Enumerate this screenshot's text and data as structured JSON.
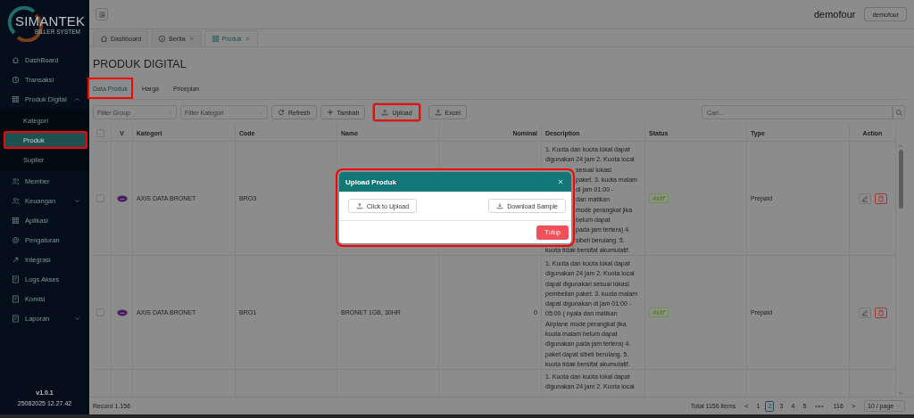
{
  "sidebar": {
    "logo": {
      "name": "SIMANTEK",
      "tagline": "BILLER SYSTEM"
    },
    "items": [
      {
        "label": "DashBoard",
        "selected": false,
        "highlighted": false
      },
      {
        "label": "Transaksi",
        "selected": false,
        "highlighted": false
      },
      {
        "label": "Produk Digital",
        "selected": false,
        "highlighted": false,
        "expanded": true,
        "children": [
          {
            "label": "Kategori",
            "selected": false,
            "highlighted": false
          },
          {
            "label": "Produk",
            "selected": true,
            "highlighted": true
          },
          {
            "label": "Suplier",
            "selected": false,
            "highlighted": false
          }
        ]
      },
      {
        "label": "Member",
        "selected": false,
        "highlighted": false
      },
      {
        "label": "Keuangan",
        "selected": false,
        "highlighted": false,
        "expanded": false
      },
      {
        "label": "Aplikasi",
        "selected": false,
        "highlighted": false
      },
      {
        "label": "Pengaturan",
        "selected": false,
        "highlighted": false
      },
      {
        "label": "Integrasi",
        "selected": false,
        "highlighted": false
      },
      {
        "label": "Logs Akses",
        "selected": false,
        "highlighted": false
      },
      {
        "label": "Komisi",
        "selected": false,
        "highlighted": false
      },
      {
        "label": "Laporan",
        "selected": false,
        "highlighted": false,
        "expanded": false
      }
    ],
    "version": "v1.0.1",
    "build": "25082025 12.27.42"
  },
  "topbar": {
    "user_name": "demofour",
    "user_button": "demofour"
  },
  "tabs": [
    {
      "label": "Dashboard",
      "kind": "home",
      "closable": false,
      "selected": false
    },
    {
      "label": "Berita",
      "kind": "info",
      "closable": true,
      "selected": false
    },
    {
      "label": "Produk",
      "kind": "grid",
      "closable": true,
      "selected": true
    }
  ],
  "page_title": "PRODUK DIGITAL",
  "subtabs": [
    {
      "label": "Data Produk",
      "selected": true,
      "highlighted": true
    },
    {
      "label": "Harga",
      "selected": false,
      "highlighted": false
    },
    {
      "label": "Priceplan",
      "selected": false,
      "highlighted": false
    }
  ],
  "toolbar": {
    "filters": [
      {
        "placeholder": "Filter Group"
      },
      {
        "placeholder": "Filter Kategori"
      }
    ],
    "buttons": [
      {
        "label": "Refresh",
        "kind": "refresh",
        "highlighted": false
      },
      {
        "label": "Tambah",
        "kind": "add",
        "highlighted": false
      },
      {
        "label": "Upload",
        "kind": "upload",
        "highlighted": true
      },
      {
        "label": "Excel",
        "kind": "upload",
        "highlighted": false
      }
    ],
    "search": {
      "placeholder": "Cari..."
    }
  },
  "table": {
    "header_checkbox": {
      "checked": false
    },
    "columns": [
      "V",
      "Kategori",
      "Code",
      "Name",
      "Nominal",
      "Description",
      "Status",
      "Type",
      "Action"
    ],
    "rows": [
      {
        "checked": false,
        "kategori": "AXIS DATA BRONET",
        "code": "BRO3",
        "description_parts": [
          {
            "text": "1. Kuota dan kuota lokal dapat",
            "kind": "lines"
          },
          {
            "text": "digunakan 24 jam 2. Kuota local",
            "kind": "lines"
          },
          {
            "text": "sesuai lokasi",
            "kind": "tail"
          },
          {
            "text": "paket. 3. kuota malam",
            "kind": "tail"
          },
          {
            "text": "di jam 01:00 -",
            "kind": "tail"
          },
          {
            "text": "dan matikan",
            "kind": "tail"
          },
          {
            "text": "mode perangkat jika",
            "kind": "tail"
          },
          {
            "text": "belum dapat",
            "kind": "tail"
          },
          {
            "text": "pada jam tertera) 4.",
            "kind": "tail"
          },
          {
            "text": "sibeli berulang. 5.",
            "kind": "tail"
          },
          {
            "text": "kuota tidak bersifat akumulatif.",
            "kind": "lines"
          }
        ],
        "status": "Aktif",
        "type": "Prepaid"
      },
      {
        "checked": false,
        "kategori": "AXIS DATA BRONET",
        "code": "BRO1",
        "name": "BRONET 1GB, 30HR",
        "nominal": "0",
        "description": "1. Kuota dan kuota lokal dapat digunakan 24 jam 2. Kuota local dapat digunakan sesuai lokasi pembelian paket. 3. kuota malam dapat digunakan di jam 01:00 - 05:00 ( nyala dan matikan Airplane mode perangkat jika kuota malam belum dapat digunakan pada jam tertera) 4. paket dapat sibeli berulang. 5. kuota tidak bersifat akumulatif.",
        "status": "Aktif",
        "type": "Prepaid"
      },
      {
        "description": "1. Kuota dan kuota lokal dapat digunakan 24 jam 2. Kuota local"
      }
    ]
  },
  "footer": {
    "record": "Record 1.156",
    "total": "Total 1156 items",
    "prev": "<",
    "next": ">",
    "pages": [
      {
        "label": "1",
        "kind": "page",
        "selected": false
      },
      {
        "label": "2",
        "kind": "page",
        "selected": true
      },
      {
        "label": "3",
        "kind": "page",
        "selected": false
      },
      {
        "label": "4",
        "kind": "page",
        "selected": false
      },
      {
        "label": "5",
        "kind": "page",
        "selected": false
      },
      {
        "label": "•••",
        "kind": "ellipsis"
      },
      {
        "label": "116",
        "kind": "page",
        "selected": false
      }
    ],
    "page_size": "10 / page"
  },
  "modal": {
    "title": "Upload Produk",
    "highlighted": true,
    "upload_button": "Click to Upload",
    "sample_button": "Download Sample",
    "close_button": "Tutup"
  }
}
